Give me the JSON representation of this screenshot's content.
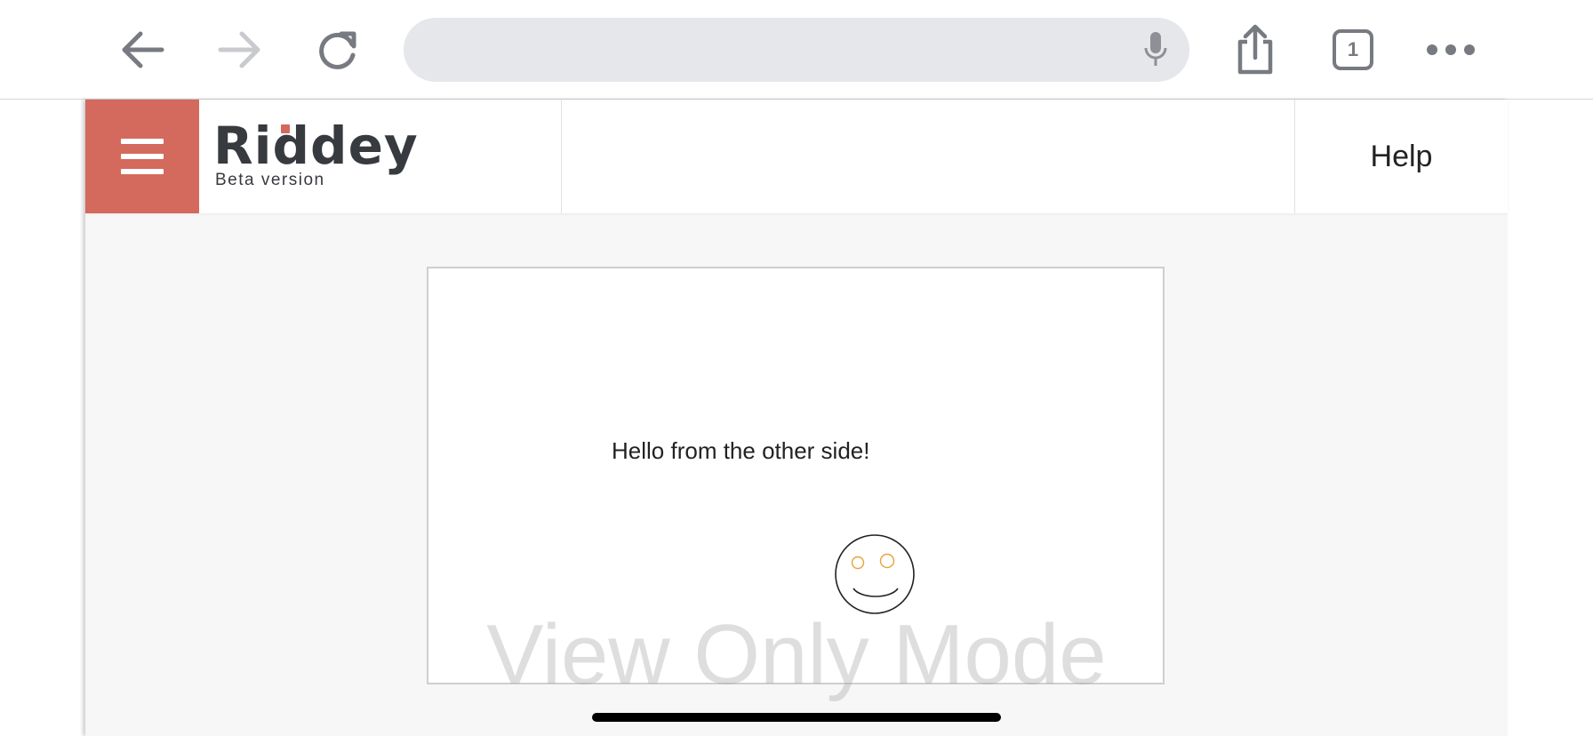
{
  "browser": {
    "url_value": "",
    "tab_count": "1",
    "icons": {
      "back": "back-arrow-icon",
      "forward": "forward-arrow-icon",
      "reload": "reload-icon",
      "mic": "microphone-icon",
      "share": "share-icon",
      "tabs": "tabs-icon",
      "more": "more-icon"
    }
  },
  "header": {
    "brand_name": "Riddey",
    "brand_subtitle": "Beta version",
    "help_label": "Help",
    "accent_color": "#d4695d"
  },
  "card": {
    "message": "Hello from the other side!"
  },
  "watermark": "View Only Mode"
}
